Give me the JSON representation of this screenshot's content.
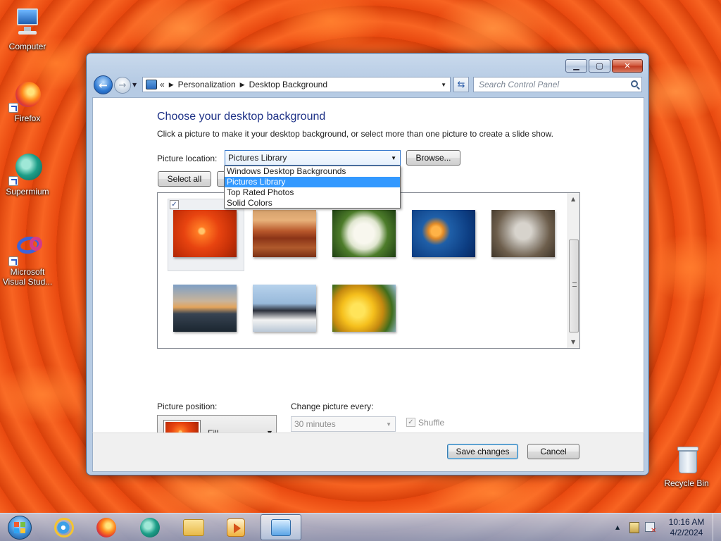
{
  "desktop": {
    "icons": [
      {
        "label": "Computer",
        "icon": "computer-icon"
      },
      {
        "label": "Firefox",
        "icon": "firefox-icon"
      },
      {
        "label": "Supermium",
        "icon": "supermium-icon"
      },
      {
        "label": "Microsoft Visual Stud...",
        "icon": "visual-studio-icon"
      },
      {
        "label": "Recycle Bin",
        "icon": "recycle-bin-icon"
      }
    ]
  },
  "window": {
    "caption_buttons": {
      "minimize": "▁",
      "maximize": "▢",
      "close": "✕"
    },
    "address": {
      "back": "←",
      "forward": "→",
      "chevrons": "«",
      "crumbs": [
        "Personalization",
        "Desktop Background"
      ],
      "separator": "▶"
    },
    "search_placeholder": "Search Control Panel",
    "heading": "Choose your desktop background",
    "description": "Click a picture to make it your desktop background, or select more than one picture to create a slide show.",
    "picture_location_label": "Picture location:",
    "picture_location_value": "Pictures Library",
    "browse_label": "Browse...",
    "select_all_label": "Select all",
    "location_options": [
      "Windows Desktop Backgrounds",
      "Pictures Library",
      "Top Rated Photos",
      "Solid Colors"
    ],
    "selected_option": "Pictures Library",
    "pictures": [
      {
        "name": "Chrysanthemum",
        "style": "t-flower",
        "checked": true
      },
      {
        "name": "Desert",
        "style": "t-desert"
      },
      {
        "name": "Hydrangeas",
        "style": "t-hydrangea"
      },
      {
        "name": "Jellyfish",
        "style": "t-jelly"
      },
      {
        "name": "Koala",
        "style": "t-koala"
      },
      {
        "name": "Lighthouse",
        "style": "t-lighthouse"
      },
      {
        "name": "Penguins",
        "style": "t-penguins"
      },
      {
        "name": "Tulips",
        "style": "t-tulips"
      }
    ],
    "picture_position_label": "Picture position:",
    "picture_position_value": "Fill",
    "change_every_label": "Change picture every:",
    "change_every_value": "30 minutes",
    "shuffle_label": "Shuffle",
    "shuffle_checked": true,
    "save_label": "Save changes",
    "cancel_label": "Cancel"
  },
  "taskbar": {
    "apps": [
      {
        "name": "internet-explorer",
        "active": false
      },
      {
        "name": "firefox",
        "active": false
      },
      {
        "name": "supermium",
        "active": false
      },
      {
        "name": "file-explorer",
        "active": false
      },
      {
        "name": "media-player",
        "active": false
      },
      {
        "name": "control-panel",
        "active": true
      }
    ],
    "clock_time": "10:16 AM",
    "clock_date": "4/2/2024"
  }
}
